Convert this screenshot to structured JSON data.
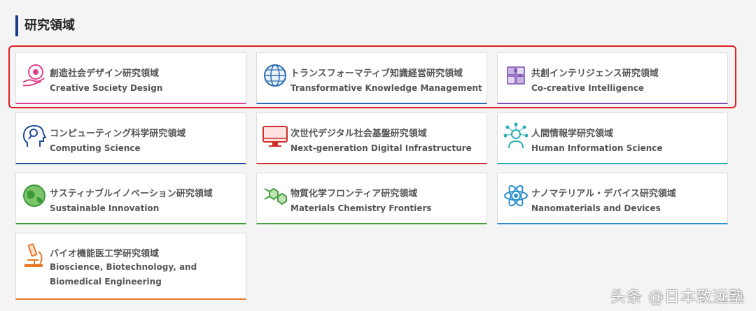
{
  "section": {
    "title": "研究領域"
  },
  "cards": [
    {
      "ja": "創造社会デザイン研究領域",
      "en": "Creative Society Design",
      "accent": "#e0408a",
      "icon": "hand-heart-icon"
    },
    {
      "ja": "トランスフォーマティブ知識経営研究領域",
      "en": "Transformative Knowledge Management",
      "accent": "#2b6cb0",
      "icon": "globe-icon"
    },
    {
      "ja": "共創インテリジェンス研究領域",
      "en": "Co-creative Intelligence",
      "accent": "#7b4fb0",
      "icon": "puzzle-icon"
    },
    {
      "ja": "コンピューティング科学研究領域",
      "en": "Computing Science",
      "accent": "#1f4f99",
      "icon": "head-magnifier-icon"
    },
    {
      "ja": "次世代デジタル社会基盤研究領域",
      "en": "Next-generation Digital Infrastructure",
      "accent": "#d0302c",
      "icon": "monitor-icon"
    },
    {
      "ja": "人間情報学研究領域",
      "en": "Human Information Science",
      "accent": "#2aaeb8",
      "icon": "network-person-icon"
    },
    {
      "ja": "サスティナブルイノベーション研究領域",
      "en": "Sustainable Innovation",
      "accent": "#3a9a3a",
      "icon": "eco-globe-icon"
    },
    {
      "ja": "物質化学フロンティア研究領域",
      "en": "Materials Chemistry Frontiers",
      "accent": "#4aa040",
      "icon": "molecule-icon"
    },
    {
      "ja": "ナノマテリアル・デバイス研究領域",
      "en": "Nanomaterials and Devices",
      "accent": "#2a8fd0",
      "icon": "atom-icon"
    },
    {
      "ja": "バイオ機能医工学研究領域",
      "en": "Bioscience, Biotechnology, and Biomedical Engineering",
      "accent": "#e8782a",
      "icon": "microscope-icon"
    }
  ],
  "watermark": "头条 @日本致远塾"
}
